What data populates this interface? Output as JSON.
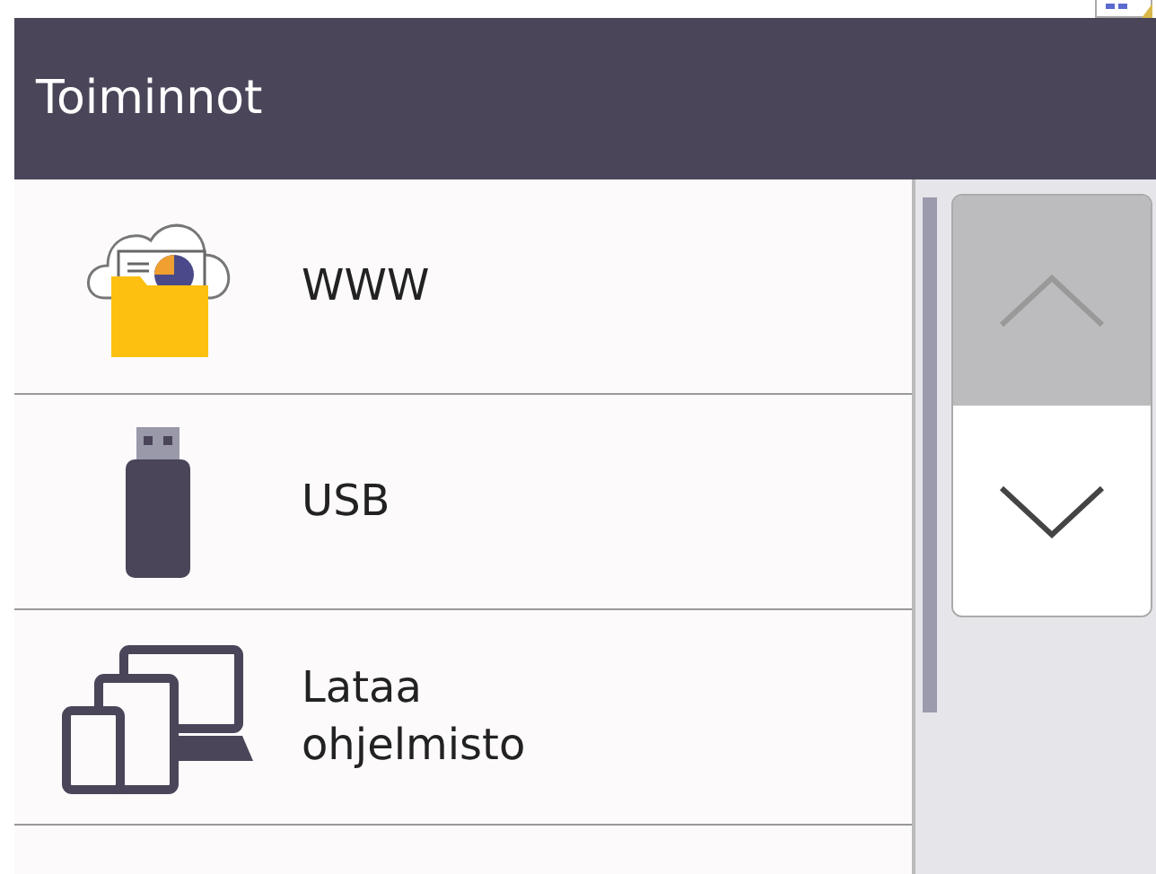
{
  "header": {
    "title": "Toiminnot"
  },
  "items": [
    {
      "label": "WWW",
      "kind": "web"
    },
    {
      "label": "USB",
      "kind": "usb"
    },
    {
      "label": "Lataa ohjelmisto",
      "kind": "download"
    }
  ],
  "scroll": {
    "up": {
      "disabled": true
    },
    "down": {
      "disabled": false
    }
  }
}
